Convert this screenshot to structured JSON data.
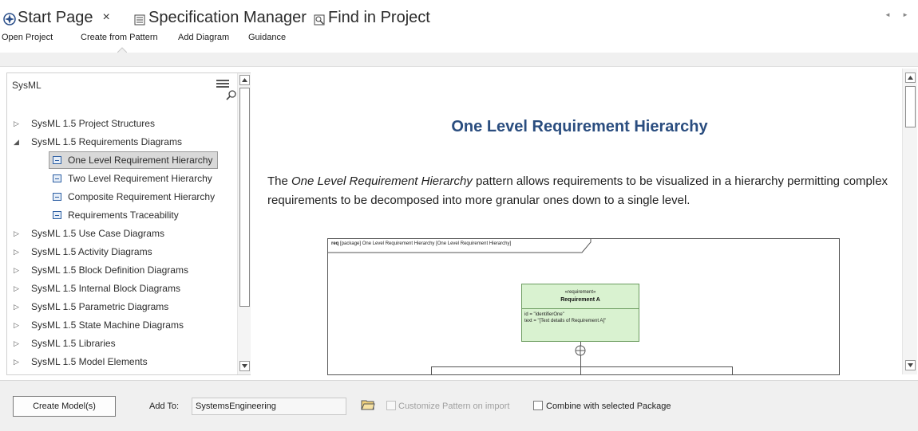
{
  "tabs": [
    {
      "label": "Start Page",
      "icon": "start-page-icon",
      "closable": true,
      "close_glyph": "×"
    },
    {
      "label": "Specification Manager",
      "icon": "spec-manager-icon"
    },
    {
      "label": "Find in Project",
      "icon": "find-in-project-icon"
    }
  ],
  "tab_scroll": "◄ ►",
  "subtoolbar": {
    "items": [
      "Open Project",
      "Create from Pattern",
      "Add Diagram",
      "Guidance"
    ],
    "active": "Create from Pattern"
  },
  "tree": {
    "header": "SysML",
    "items": [
      {
        "label": "SysML 1.5 Project Structures",
        "expander": "▷",
        "level": 0
      },
      {
        "label": "SysML 1.5 Requirements Diagrams",
        "expander": "◢",
        "level": 0
      },
      {
        "label": "One Level Requirement Hierarchy",
        "level": 1,
        "selected": true
      },
      {
        "label": "Two Level Requirement Hierarchy",
        "level": 1
      },
      {
        "label": "Composite Requirement Hierarchy",
        "level": 1
      },
      {
        "label": "Requirements Traceability",
        "level": 1
      },
      {
        "label": "SysML 1.5 Use Case Diagrams",
        "expander": "▷",
        "level": 0
      },
      {
        "label": "SysML 1.5 Activity Diagrams",
        "expander": "▷",
        "level": 0
      },
      {
        "label": "SysML 1.5 Block Definition Diagrams",
        "expander": "▷",
        "level": 0
      },
      {
        "label": "SysML 1.5 Internal Block Diagrams",
        "expander": "▷",
        "level": 0
      },
      {
        "label": "SysML 1.5 Parametric Diagrams",
        "expander": "▷",
        "level": 0
      },
      {
        "label": "SysML 1.5 State Machine Diagrams",
        "expander": "▷",
        "level": 0
      },
      {
        "label": "SysML 1.5 Libraries",
        "expander": "▷",
        "level": 0
      },
      {
        "label": "SysML 1.5 Model Elements",
        "expander": "▷",
        "level": 0
      }
    ]
  },
  "detail": {
    "title": "One Level Requirement Hierarchy",
    "desc_prefix": "The ",
    "desc_emphasis": "One Level Requirement Hierarchy",
    "desc_suffix": " pattern allows requirements to be visualized in a hierarchy permitting complex requirements to be decomposed into more granular ones down to a single level."
  },
  "diagram": {
    "frame_keyword": "req",
    "frame_text": " [package] One Level Requirement Hierarchy [One Level Requirement Hierarchy]",
    "requirement": {
      "stereotype": "«requirement»",
      "name": "Requirement A",
      "attr_id": "id = \"identifierOne\"",
      "attr_text": "text = \"[Text details of Requirement A]\""
    }
  },
  "bottom": {
    "create_button": "Create Model(s)",
    "add_to_label": "Add To:",
    "add_to_value": "SystemsEngineering",
    "customize_label": "Customize Pattern on import",
    "combine_label": "Combine with selected Package"
  },
  "colors": {
    "title_blue": "#2a4d7f",
    "requirement_fill": "#d9f2d0",
    "selection": "#d9d9d9"
  }
}
